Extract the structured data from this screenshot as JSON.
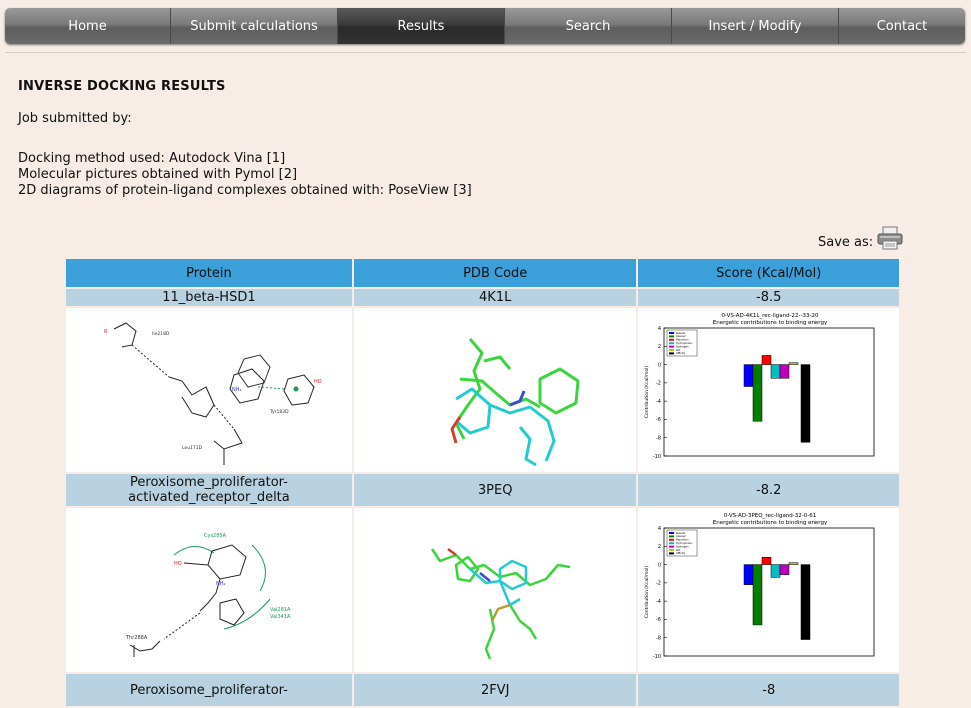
{
  "nav": {
    "items": [
      {
        "label": "Home",
        "active": false
      },
      {
        "label": "Submit calculations",
        "active": false
      },
      {
        "label": "Results",
        "active": true
      },
      {
        "label": "Search",
        "active": false
      },
      {
        "label": "Insert / Modify",
        "active": false
      },
      {
        "label": "Contact",
        "active": false
      }
    ]
  },
  "page": {
    "title": "INVERSE DOCKING RESULTS",
    "submitted_by": "Job submitted by:",
    "docking_method": "Docking method used: Autodock Vina [1]",
    "molecular_pictures": "Molecular pictures obtained with Pymol [2]",
    "diagrams_2d": "2D diagrams of protein-ligand complexes obtained with: PoseView [3]",
    "save_as": "Save as:",
    "printer_icon": "printer-icon"
  },
  "table": {
    "headers": [
      "Protein",
      "PDB Code",
      "Score (Kcal/Mol)"
    ],
    "rows": [
      {
        "protein": "11_beta-HSD1",
        "pdb": "4K1L",
        "score": "-8.5",
        "chart_title_1": "0-VS-AD-4K1L_rec-ligand-22--33-20",
        "chart_title_2": "Energetic contributions to binding energy",
        "pose_labels": [
          "Ile218D",
          "Tyr183D",
          "Leu171D"
        ]
      },
      {
        "protein": "Peroxisome_proliferator-activated_receptor_delta",
        "pdb": "3PEQ",
        "score": "-8.2",
        "chart_title_1": "0-VS-AD-3PEQ_rec-ligand-32-0-61",
        "chart_title_2": "Energetic contributions to binding energy",
        "pose_labels": [
          "Cys285A",
          "Val281A",
          "Val341A",
          "Thr288A"
        ]
      },
      {
        "protein": "Peroxisome_proliferator-",
        "pdb": "2FVJ",
        "score": "-8"
      }
    ]
  },
  "chart_data": [
    {
      "type": "bar",
      "title": "0-VS-AD-4K1L_rec-ligand-22--33-20",
      "subtitle": "Energetic contributions to binding energy",
      "ylabel": "Contribution (Kcal/mol)",
      "ylim": [
        -10,
        4
      ],
      "yticks": [
        4,
        2,
        0,
        -2,
        -4,
        -6,
        -8,
        -10
      ],
      "categories": [
        "Gauss1",
        "Gauss2",
        "Repulsion",
        "Hydrophobic",
        "Hydrogen",
        "Rot",
        "Affinity"
      ],
      "colors": [
        "#0000ff",
        "#007f00",
        "#ff0000",
        "#00bfbf",
        "#bf00bf",
        "#bfbf00",
        "#000000"
      ],
      "values": [
        -2.4,
        -6.2,
        1.0,
        -1.5,
        -1.5,
        0.2,
        -8.5
      ]
    },
    {
      "type": "bar",
      "title": "0-VS-AD-3PEQ_rec-ligand-32-0-61",
      "subtitle": "Energetic contributions to binding energy",
      "ylabel": "Contribution (Kcal/mol)",
      "ylim": [
        -10,
        4
      ],
      "yticks": [
        4,
        2,
        0,
        -2,
        -4,
        -6,
        -8,
        -10
      ],
      "categories": [
        "Gauss1",
        "Gauss2",
        "Repulsion",
        "Hydrophobic",
        "Hydrogen",
        "Rot",
        "Affinity"
      ],
      "colors": [
        "#0000ff",
        "#007f00",
        "#ff0000",
        "#00bfbf",
        "#bf00bf",
        "#bfbf00",
        "#000000"
      ],
      "values": [
        -2.2,
        -6.6,
        0.8,
        -1.4,
        -1.1,
        0.2,
        -8.2
      ]
    }
  ]
}
